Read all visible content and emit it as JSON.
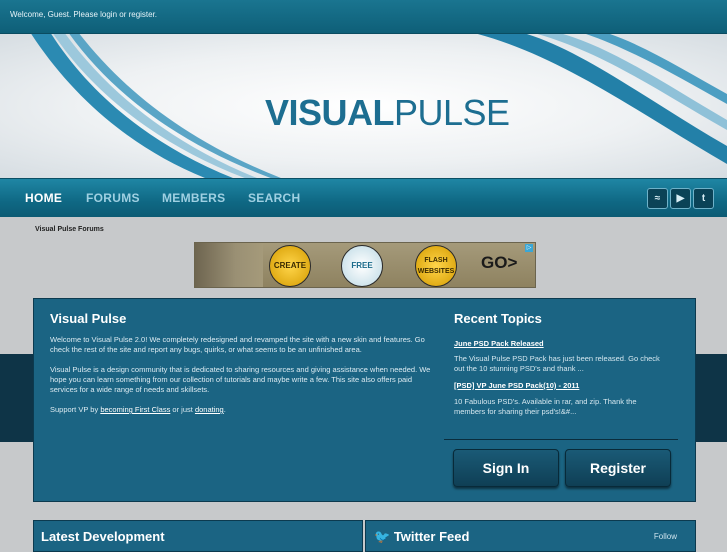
{
  "topbar": {
    "welcome": "Welcome, Guest. Please login or register."
  },
  "header": {
    "logo_bold": "VISUAL",
    "logo_regular": "PULSE"
  },
  "nav": {
    "items": [
      "HOME",
      "FORUMS",
      "MEMBERS",
      "SEARCH"
    ],
    "active": "HOME"
  },
  "social": {
    "icons": [
      "rss-icon",
      "youtube-icon",
      "twitter-icon"
    ],
    "labels": [
      "≈",
      "▶",
      "t"
    ]
  },
  "breadcrumb": "Visual Pulse Forums",
  "ad": {
    "buttons": [
      "CREATE",
      "FREE",
      "FLASH WEBSITES"
    ],
    "go": "GO>"
  },
  "main": {
    "title": "Visual Pulse",
    "para1": "Welcome to Visual Pulse 2.0! We completely redesigned and revamped the site with a new skin and features. Go check the rest of the site and report any bugs, quirks, or what seems to be an unfinished area.",
    "para2": "Visual Pulse is a design community that is dedicated to sharing resources and giving assistance when needed. We hope you can learn something from our collection of tutorials and maybe write a few. This site also offers paid services for a wide range of needs and skillsets.",
    "support_prefix": "Support VP by ",
    "support_link1": "becoming First Class",
    "support_mid": " or just ",
    "support_link2": "donating",
    "support_suffix": "."
  },
  "recent": {
    "title": "Recent Topics",
    "topics": [
      {
        "title": "June PSD Pack Released",
        "body": "The Visual Pulse PSD Pack has just been released. Go check out the 10 stunning PSD's and thank ..."
      },
      {
        "title": "[PSD] VP June PSD Pack(10) - 2011",
        "body": "10 Fabulous PSD's. Available in rar, and zip. Thank the members for sharing their psd's!&#..."
      }
    ]
  },
  "auth": {
    "sign_in": "Sign In",
    "register": "Register"
  },
  "lower": {
    "latest": "Latest Development",
    "twitter": "Twitter Feed",
    "follow": "Follow"
  },
  "colors": {
    "primary": "#1b6483",
    "nav": "#0f6884",
    "dark_band": "#0e3447",
    "logo": "#1d6e91"
  }
}
